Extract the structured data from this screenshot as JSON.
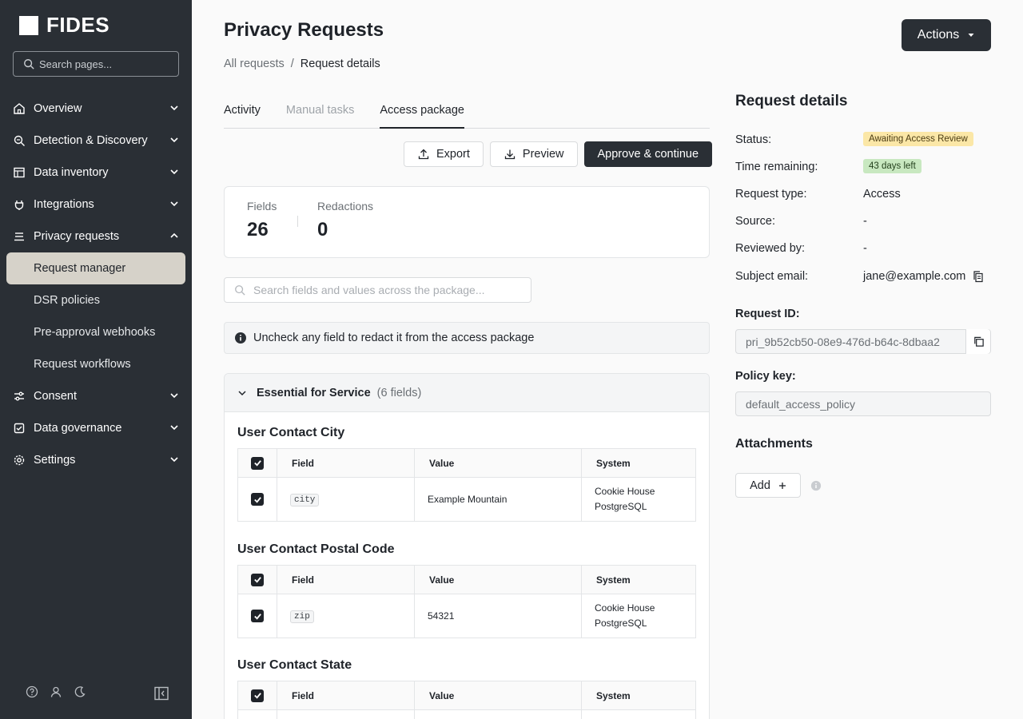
{
  "brand": {
    "name": "FIDES"
  },
  "sidebar": {
    "search_placeholder": "Search pages...",
    "items": [
      {
        "label": "Overview",
        "icon": "home-icon"
      },
      {
        "label": "Detection & Discovery",
        "icon": "search-scan-icon"
      },
      {
        "label": "Data inventory",
        "icon": "table-icon"
      },
      {
        "label": "Integrations",
        "icon": "plug-icon"
      },
      {
        "label": "Privacy requests",
        "icon": "list-icon"
      }
    ],
    "sub_items": [
      {
        "label": "Request manager"
      },
      {
        "label": "DSR policies"
      },
      {
        "label": "Pre-approval webhooks"
      },
      {
        "label": "Request workflows"
      }
    ],
    "items_after": [
      {
        "label": "Consent",
        "icon": "sliders-icon"
      },
      {
        "label": "Data governance",
        "icon": "shield-check-icon"
      },
      {
        "label": "Settings",
        "icon": "gear-icon"
      }
    ]
  },
  "header": {
    "title": "Privacy Requests",
    "actions_label": "Actions",
    "breadcrumb": {
      "root": "All requests",
      "separator": "/",
      "current": "Request details"
    }
  },
  "tabs": [
    {
      "label": "Activity"
    },
    {
      "label": "Manual tasks"
    },
    {
      "label": "Access package"
    }
  ],
  "toolbar": {
    "export": "Export",
    "preview": "Preview",
    "approve": "Approve & continue"
  },
  "stats": {
    "fields_label": "Fields",
    "fields_value": "26",
    "redactions_label": "Redactions",
    "redactions_value": "0"
  },
  "package_search": {
    "placeholder": "Search fields and values across the package..."
  },
  "info": {
    "text": "Uncheck any field to redact it from the access package"
  },
  "section": {
    "name": "Essential for Service",
    "count": "(6 fields)",
    "columns": {
      "field": "Field",
      "value": "Value",
      "system": "System"
    },
    "groups": [
      {
        "title": "User Contact City",
        "field": "city",
        "value": "Example Mountain",
        "system_line1": "Cookie House",
        "system_line2": "PostgreSQL"
      },
      {
        "title": "User Contact Postal Code",
        "field": "zip",
        "value": "54321",
        "system_line1": "Cookie House",
        "system_line2": "PostgreSQL"
      },
      {
        "title": "User Contact State"
      }
    ]
  },
  "details": {
    "title": "Request details",
    "status_label": "Status:",
    "status_value": "Awaiting Access Review",
    "time_label": "Time remaining:",
    "time_value": "43 days left",
    "type_label": "Request type:",
    "type_value": "Access",
    "source_label": "Source:",
    "source_value": "-",
    "reviewed_label": "Reviewed by:",
    "reviewed_value": "-",
    "email_label": "Subject email:",
    "email_value": "jane@example.com",
    "request_id_label": "Request ID:",
    "request_id_value": "pri_9b52cb50-08e9-476d-b64c-8dbaa2",
    "policy_key_label": "Policy key:",
    "policy_key_value": "default_access_policy",
    "attachments_title": "Attachments",
    "add_label": "Add"
  },
  "colors": {
    "sidebar_bg": "#2a2f35",
    "active_item_bg": "#d6d2c9",
    "status_warn": "#fbe7a7",
    "status_ok": "#c8e8c0"
  }
}
